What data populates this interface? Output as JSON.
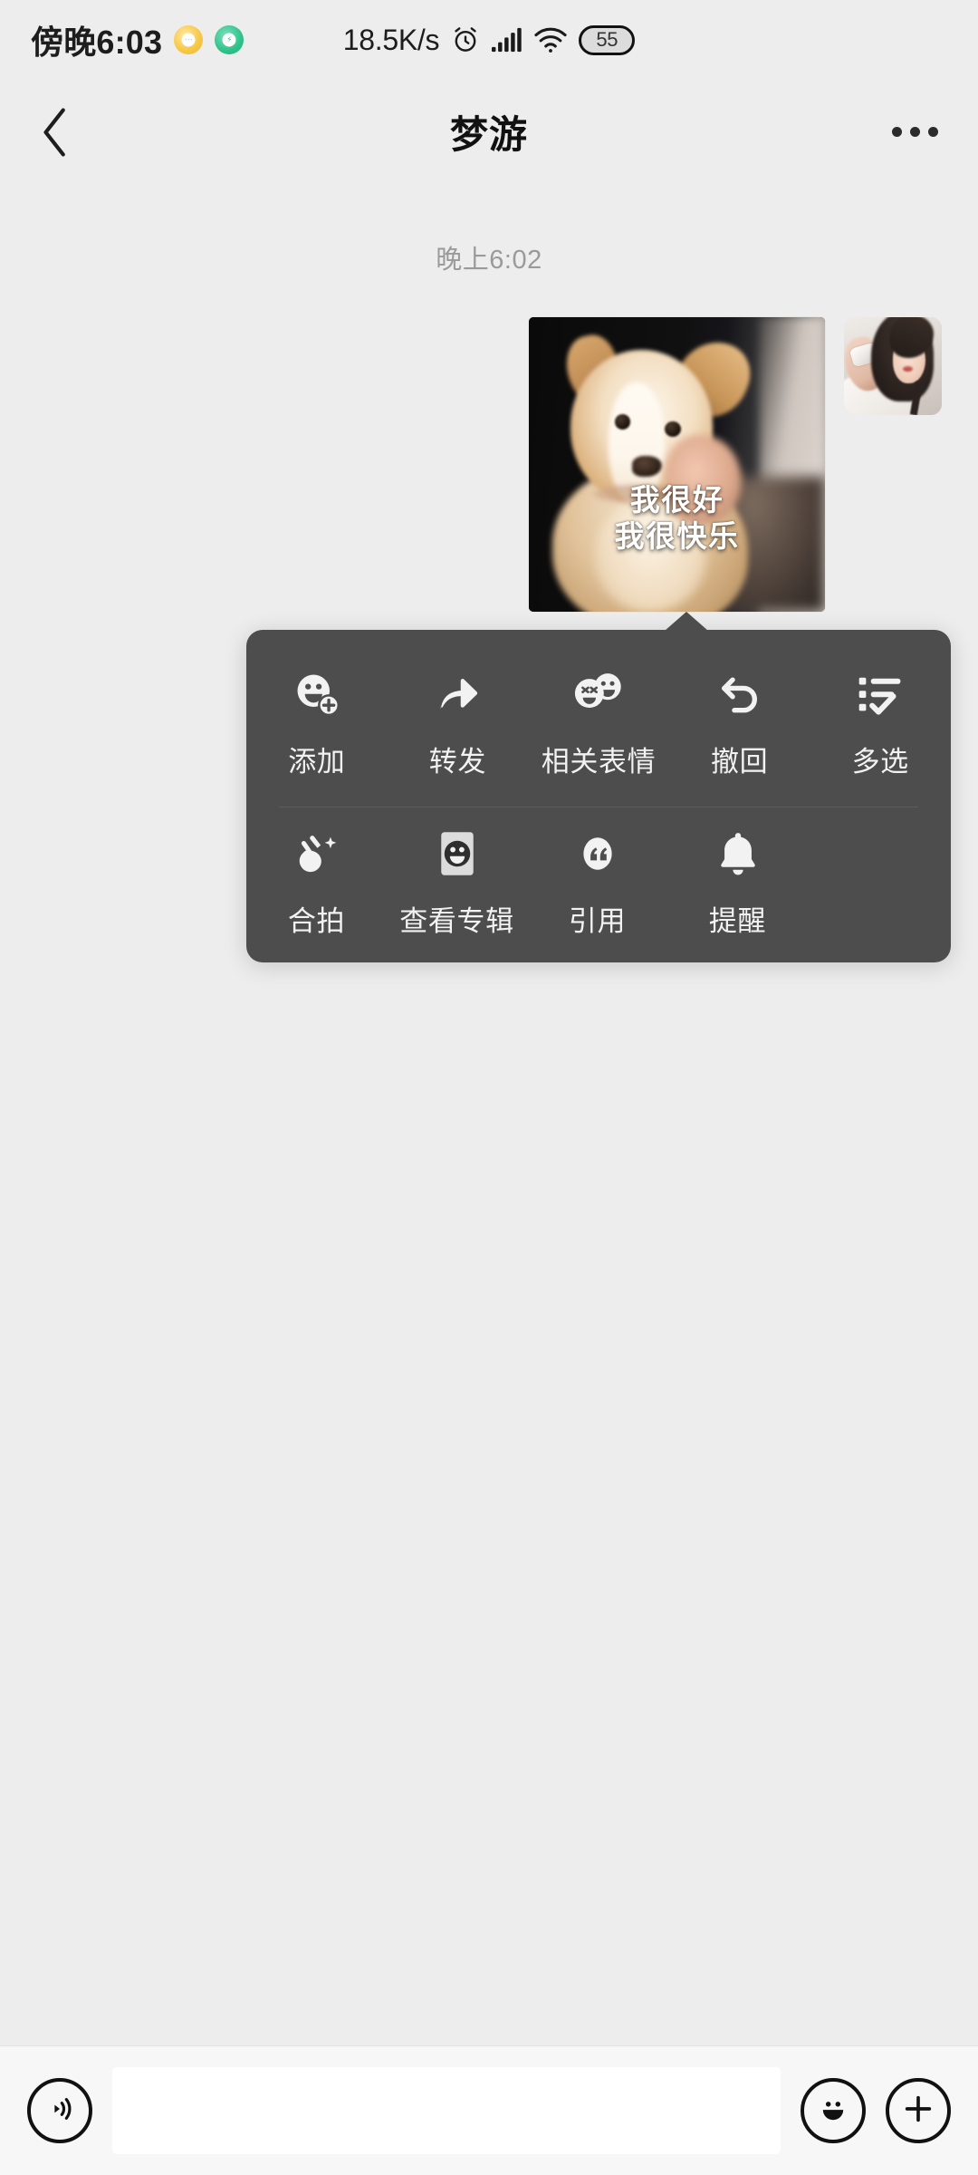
{
  "status_bar": {
    "time": "傍晚6:03",
    "network_speed": "18.5K/s",
    "battery_level": "55",
    "icons": [
      "alarm-clock-icon",
      "signal-bars-icon",
      "wifi-icon",
      "battery-icon"
    ],
    "app_dot_left": "yellow-app-dot",
    "app_dot_right": "green-app-dot"
  },
  "header": {
    "back_icon": "chevron-left-icon",
    "title": "梦游",
    "more_icon": "more-dots-icon"
  },
  "chat": {
    "timestamp": "晚上6:02",
    "message": {
      "type": "image",
      "caption_line1": "我很好",
      "caption_line2": "我很快乐",
      "alt": "corgi-puppy-held-by-hands",
      "side": "outgoing"
    },
    "avatar_alt": "user-avatar-photo"
  },
  "context_menu": {
    "row1": [
      {
        "label": "添加",
        "icon": "add-emoji-icon"
      },
      {
        "label": "转发",
        "icon": "forward-arrow-icon"
      },
      {
        "label": "相关表情",
        "icon": "related-stickers-icon"
      },
      {
        "label": "撤回",
        "icon": "undo-recall-icon"
      },
      {
        "label": "多选",
        "icon": "multi-select-list-icon"
      }
    ],
    "row2": [
      {
        "label": "合拍",
        "icon": "duet-hand-icon"
      },
      {
        "label": "查看专辑",
        "icon": "album-smiley-icon"
      },
      {
        "label": "引用",
        "icon": "quote-marks-icon"
      },
      {
        "label": "提醒",
        "icon": "bell-reminder-icon"
      }
    ]
  },
  "input_bar": {
    "voice_icon": "voice-wave-icon",
    "text_value": "",
    "text_placeholder": "",
    "emoji_icon": "emoji-smiley-icon",
    "plus_icon": "plus-icon"
  },
  "colors": {
    "page_bg": "#ededed",
    "menu_bg": "#4d4d4d",
    "menu_text": "#f2f2f2",
    "timestamp_text": "#9a9a9a",
    "input_bar_bg": "#f7f7f7"
  }
}
